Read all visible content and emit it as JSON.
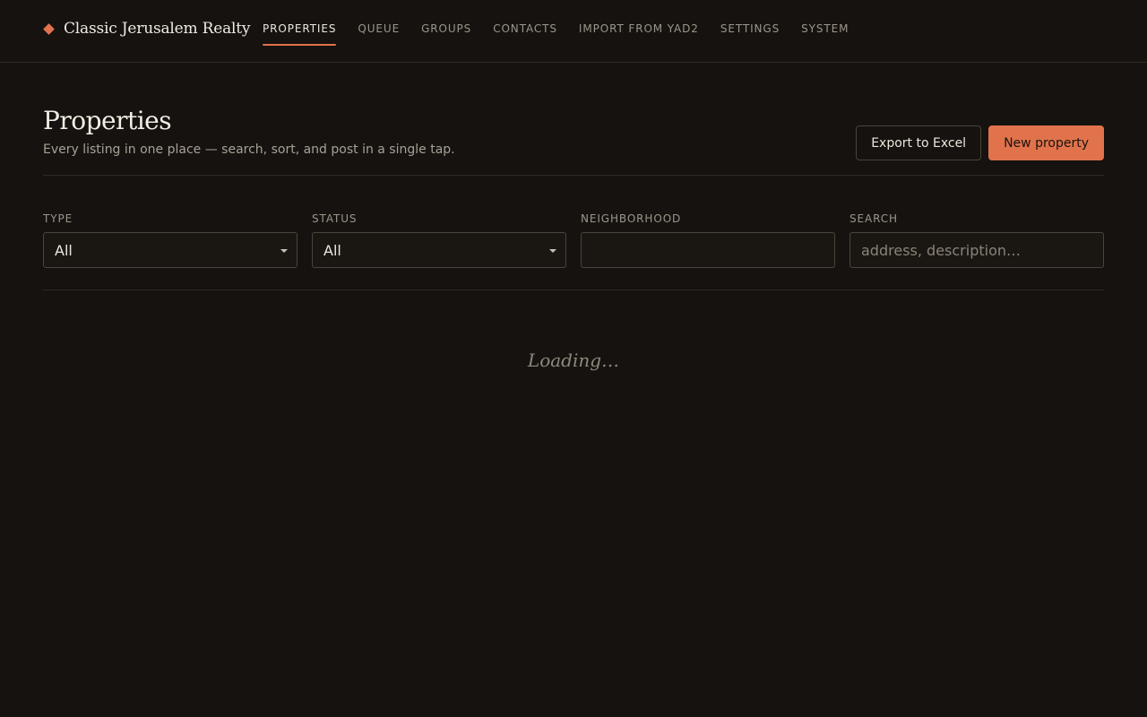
{
  "brand": {
    "name": "Classic Jerusalem Realty",
    "icon": "diamond-icon",
    "accent": "#e0734c"
  },
  "nav": {
    "items": [
      {
        "label": "PROPERTIES",
        "active": true
      },
      {
        "label": "QUEUE"
      },
      {
        "label": "GROUPS"
      },
      {
        "label": "CONTACTS"
      },
      {
        "label": "IMPORT FROM YAD2"
      },
      {
        "label": "SETTINGS"
      },
      {
        "label": "SYSTEM"
      }
    ]
  },
  "header": {
    "title": "Properties",
    "subtitle": "Every listing in one place — search, sort, and post in a single tap.",
    "export_label": "Export to Excel",
    "new_label": "New property"
  },
  "filters": {
    "type": {
      "label": "TYPE",
      "value": "All"
    },
    "status": {
      "label": "STATUS",
      "value": "All"
    },
    "neighborhood": {
      "label": "NEIGHBORHOOD",
      "value": ""
    },
    "search": {
      "label": "SEARCH",
      "placeholder": "address, description…",
      "value": ""
    }
  },
  "status": {
    "loading_text": "Loading…"
  },
  "colors": {
    "background": "#15120f",
    "accent": "#e0734c",
    "border": "#2e2a24"
  }
}
